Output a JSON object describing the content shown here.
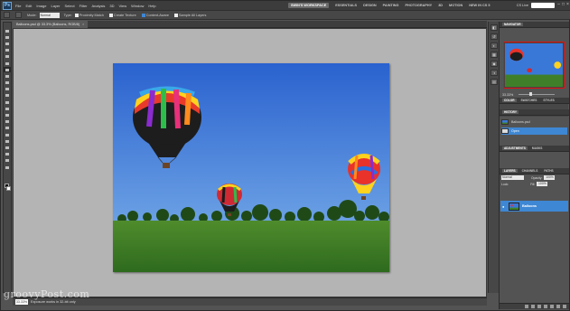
{
  "app": {
    "logo": "Ps",
    "menu": [
      "File",
      "Edit",
      "Image",
      "Layer",
      "Select",
      "Filter",
      "Analysis",
      "3D",
      "View",
      "Window",
      "Help"
    ],
    "workspaces": [
      "SWIN'S WORKSPACE",
      "ESSENTIALS",
      "DESIGN",
      "PAINTING",
      "PHOTOGRAPHY",
      "3D",
      "MOTION",
      "NEW IN CS 5"
    ],
    "active_workspace": "SWIN'S WORKSPACE",
    "cs_live": "CS Live",
    "window_buttons": [
      "–",
      "□",
      "×"
    ]
  },
  "options": {
    "mode_label": "Mode:",
    "mode_value": "Normal",
    "type_label": "Type:",
    "checks": [
      "Proximity Match",
      "Create Texture",
      "Content-Aware"
    ],
    "sample_all": "Sample All Layers"
  },
  "document": {
    "tab_title": "Balloons.psd @ 33.3% (Balloons, RGB/8)",
    "tab_close": "×",
    "zoom": "33.33%",
    "status": "Exposure works in 32-bit only"
  },
  "watermark": "groovyPost.com",
  "panels": {
    "navigator": {
      "tabs": [
        "NAVIGATOR"
      ],
      "zoom": "33.33%"
    },
    "history": {
      "tabs": [
        "COLOR",
        "SWATCHES",
        "STYLES"
      ],
      "title": "HISTORY",
      "items": [
        "Balloons.psd",
        "Open"
      ]
    },
    "adjustments": {
      "tabs": [
        "ADJUSTMENTS",
        "MASKS"
      ]
    },
    "layers": {
      "tabs": [
        "LAYERS",
        "CHANNELS",
        "PATHS"
      ],
      "blend": "Normal",
      "opacity_label": "Opacity:",
      "opacity": "100%",
      "lock_label": "Lock:",
      "fill_label": "Fill:",
      "fill": "100%",
      "layer_name": "Balloons"
    }
  },
  "colors": {
    "accent": "#3e87d4",
    "navigator_frame": "#e01010",
    "sky_top": "#2f6fd6",
    "grass": "#3f7f2a"
  },
  "dock_icons": [
    "navigator-icon",
    "history-icon",
    "color-icon",
    "swatches-icon",
    "styles-icon",
    "adjustments-icon",
    "layers-icon"
  ]
}
